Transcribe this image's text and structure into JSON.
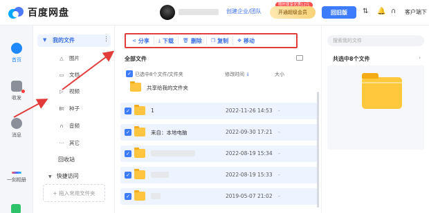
{
  "header": {
    "logo_text": "百度网盘",
    "create_team": "创建企业/团队",
    "vip_tag": "限时尊享优惠12元",
    "vip_button": "开通超级会员",
    "return_button": "回旧版",
    "client_download": "客户端下"
  },
  "rail": {
    "home": "首页",
    "inbox": "收发",
    "messages": "消息",
    "moments": "一刻相册"
  },
  "categories": {
    "my_files": "我的文件",
    "items": [
      {
        "label": "图片",
        "icon": "image-icon"
      },
      {
        "label": "文档",
        "icon": "document-icon"
      },
      {
        "label": "视频",
        "icon": "video-icon"
      },
      {
        "label": "种子",
        "icon": "torrent-icon"
      },
      {
        "label": "音频",
        "icon": "audio-icon"
      },
      {
        "label": "其它",
        "icon": "more-icon"
      }
    ],
    "recycle": "回收站",
    "quick_access": "快捷访问",
    "drop_hint": "+ 拖入常用文件夹"
  },
  "toolbar": {
    "share": "分享",
    "download": "下载",
    "delete": "删除",
    "copy": "复制",
    "move": "移动"
  },
  "main": {
    "all_files": "全部文件",
    "select_summary": "已选中8个文件/文件夹",
    "col_mtime": "修改时间",
    "col_size": "大小",
    "files": [
      {
        "name": "共享给我的文件夹",
        "date": "",
        "size": "",
        "checked": false,
        "blurred": false
      },
      {
        "name": "1",
        "date": "2022-11-26 14:53",
        "size": "-",
        "checked": true,
        "blurred": false
      },
      {
        "name": "来自：本地电脑",
        "date": "2022-09-30 17:21",
        "size": "-",
        "checked": true,
        "blurred": false
      },
      {
        "name": "",
        "date": "2022-08-19 15:34",
        "size": "-",
        "checked": true,
        "blurred": true
      },
      {
        "name": "",
        "date": "2022-08-19 15:33",
        "size": "-",
        "checked": true,
        "blurred": true
      },
      {
        "name": "",
        "date": "2019-05-07 21:02",
        "size": "-",
        "checked": true,
        "blurred": true
      }
    ]
  },
  "detail": {
    "search_placeholder": "搜索我的文件",
    "selected_count": "共选中8个文件"
  },
  "colors": {
    "accent": "#3e7cff",
    "annotation": "#e23b3b",
    "folder": "#ffc440"
  }
}
